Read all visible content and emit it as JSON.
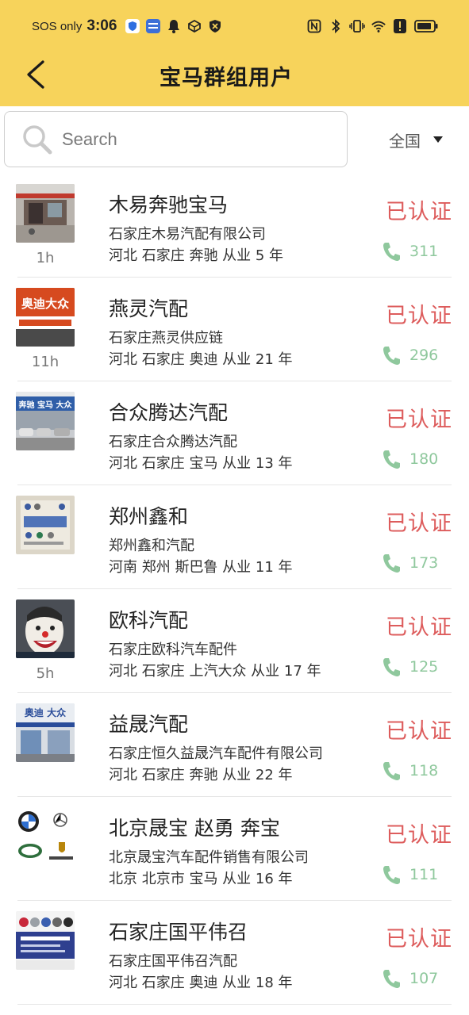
{
  "status_bar": {
    "carrier": "SOS only",
    "time": "3:06"
  },
  "header": {
    "title": "宝马群组用户"
  },
  "search": {
    "placeholder": "Search"
  },
  "region": {
    "label": "全国"
  },
  "colors": {
    "header_bg": "#f7d35b",
    "verified": "#dd5c5c",
    "calls": "#8fc89d"
  },
  "users": [
    {
      "name": "木易奔驰宝马",
      "company": "石家庄木易汽配有限公司",
      "meta": "河北 石家庄 奔驰 从业 5 年",
      "badge": "已认证",
      "calls": "311",
      "ago": "1h",
      "avatar": "storefront-photo"
    },
    {
      "name": "燕灵汽配",
      "company": "石家庄燕灵供应链",
      "meta": "河北 石家庄 奥迪 从业 21 年",
      "badge": "已认证",
      "calls": "296",
      "ago": "11h",
      "avatar": "audi-vw-sign"
    },
    {
      "name": "合众腾达汽配",
      "company": "石家庄合众腾达汽配",
      "meta": "河北 石家庄 宝马 从业 13 年",
      "badge": "已认证",
      "calls": "180",
      "ago": "",
      "avatar": "shop-front-cars"
    },
    {
      "name": "郑州鑫和",
      "company": "郑州鑫和汽配",
      "meta": "河南 郑州 斯巴鲁 从业 11 年",
      "badge": "已认证",
      "calls": "173",
      "ago": "",
      "avatar": "brand-logos-card"
    },
    {
      "name": "欧科汽配",
      "company": "石家庄欧科汽车配件",
      "meta": "河北 石家庄 上汽大众 从业 17 年",
      "badge": "已认证",
      "calls": "125",
      "ago": "5h",
      "avatar": "clown-face"
    },
    {
      "name": "益晟汽配",
      "company": "石家庄恒久益晟汽车配件有限公司",
      "meta": "河北 石家庄 奔驰 从业 22 年",
      "badge": "已认证",
      "calls": "118",
      "ago": "",
      "avatar": "audi-vw-storefront"
    },
    {
      "name": "北京晟宝 赵勇 奔宝",
      "company": "北京晟宝汽车配件销售有限公司",
      "meta": "北京 北京市 宝马 从业 16 年",
      "badge": "已认证",
      "calls": "111",
      "ago": "",
      "avatar": "bmw-mercedes-landrover-porsche-logos"
    },
    {
      "name": "石家庄国平伟召",
      "company": "石家庄国平伟召汽配",
      "meta": "河北 石家庄 奥迪 从业 18 年",
      "badge": "已认证",
      "calls": "107",
      "ago": "",
      "avatar": "brand-logos-banner"
    }
  ],
  "logo_texts": {
    "thumb2": "奥迪大众",
    "thumb3": "奔驰 宝马 大众",
    "thumb6": "奥迪 大众"
  }
}
